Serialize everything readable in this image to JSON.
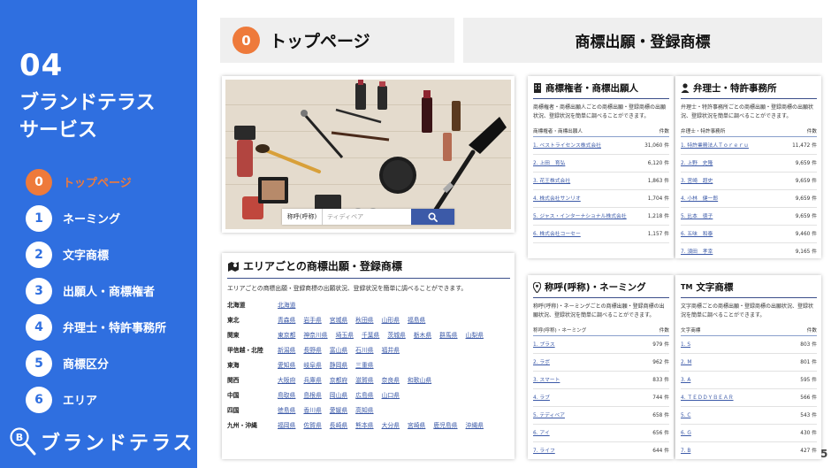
{
  "sidebar": {
    "number": "04",
    "title_line1": "ブランドテラス",
    "title_line2": "サービス",
    "menu": [
      {
        "num": "0",
        "label": "トップページ",
        "active": true
      },
      {
        "num": "1",
        "label": "ネーミング",
        "active": false
      },
      {
        "num": "2",
        "label": "文字商標",
        "active": false
      },
      {
        "num": "3",
        "label": "出願人・商標権者",
        "active": false
      },
      {
        "num": "4",
        "label": "弁理士・特許事務所",
        "active": false
      },
      {
        "num": "5",
        "label": "商標区分",
        "active": false
      },
      {
        "num": "6",
        "label": "エリア",
        "active": false
      }
    ],
    "brand": "ブランドテラス",
    "brand_icon_letter": "B"
  },
  "header": {
    "left_num": "0",
    "left_title": "トップページ",
    "right_title": "商標出願・登録商標"
  },
  "hero": {
    "search_select": "称呼(呼称)",
    "search_placeholder": "ティディベア"
  },
  "area_card": {
    "title": "エリアごとの商標出願・登録商標",
    "desc": "エリアごとの商標出願・登録商標の出願状況、登録状況を簡単に調べることができます。",
    "rows": [
      {
        "region": "北海道",
        "prefs": [
          "北海道"
        ]
      },
      {
        "region": "東北",
        "prefs": [
          "青森県",
          "岩手県",
          "宮城県",
          "秋田県",
          "山形県",
          "福島県"
        ]
      },
      {
        "region": "関東",
        "prefs": [
          "東京都",
          "神奈川県",
          "埼玉県",
          "千葉県",
          "茨城県",
          "栃木県",
          "群馬県",
          "山梨県"
        ]
      },
      {
        "region": "甲信越・北陸",
        "prefs": [
          "新潟県",
          "長野県",
          "富山県",
          "石川県",
          "福井県"
        ]
      },
      {
        "region": "東海",
        "prefs": [
          "愛知県",
          "岐阜県",
          "静岡県",
          "三重県"
        ]
      },
      {
        "region": "関西",
        "prefs": [
          "大阪府",
          "兵庫県",
          "京都府",
          "滋賀県",
          "奈良県",
          "和歌山県"
        ]
      },
      {
        "region": "中国",
        "prefs": [
          "鳥取県",
          "島根県",
          "岡山県",
          "広島県",
          "山口県"
        ]
      },
      {
        "region": "四国",
        "prefs": [
          "徳島県",
          "香川県",
          "愛媛県",
          "高知県"
        ]
      },
      {
        "region": "九州・沖縄",
        "prefs": [
          "福岡県",
          "佐賀県",
          "長崎県",
          "熊本県",
          "大分県",
          "宮崎県",
          "鹿児島県",
          "沖縄県"
        ]
      }
    ]
  },
  "owner_card": {
    "title": "商標権者・商標出願人",
    "desc": "商標権者・商標出願人ごとの商標出願・登録商標の出願状況、登録状況を簡単に調べることができます。",
    "col_name": "商標権者・商標出願人",
    "col_count": "件数",
    "rows": [
      {
        "name": "1. ベストライセンス株式会社",
        "count": "31,060 件"
      },
      {
        "name": "2. 上田　育弘",
        "count": "6,120 件"
      },
      {
        "name": "3. 花王株式会社",
        "count": "1,863 件"
      },
      {
        "name": "4. 株式会社サンリオ",
        "count": "1,704 件"
      },
      {
        "name": "5. ジャス・インターナショナル株式会社",
        "count": "1,218 件"
      },
      {
        "name": "6. 株式会社コーセー",
        "count": "1,157 件"
      }
    ]
  },
  "attorney_card": {
    "title": "弁理士・特許事務所",
    "desc": "弁理士・特許事務所ごとの商標出願・登録商標の出願状況、登録状況を簡単に調べることができます。",
    "col_name": "弁理士・特許事務所",
    "col_count": "件数",
    "rows": [
      {
        "name": "1. 特許業務法人Ｔｏｒｅｒｕ",
        "count": "11,472 件"
      },
      {
        "name": "2. 上野　史隆",
        "count": "9,659 件"
      },
      {
        "name": "3. 宮崎　超史",
        "count": "9,659 件"
      },
      {
        "name": "4. 小林　健一郎",
        "count": "9,659 件"
      },
      {
        "name": "5. 比本　徳子",
        "count": "9,659 件"
      },
      {
        "name": "6. 五味　和泰",
        "count": "9,460 件"
      },
      {
        "name": "7. 須田　孝幸",
        "count": "9,165 件"
      }
    ]
  },
  "naming_card": {
    "title": "称呼(呼称)・ネーミング",
    "desc": "称呼(呼称)・ネーミングごとの商標出願・登録商標の出願状況、登録状況を簡単に調べることができます。",
    "col_name": "称呼(呼称)・ネーミング",
    "col_count": "件数",
    "rows": [
      {
        "name": "1. プラス",
        "count": "979 件"
      },
      {
        "name": "2. ラボ",
        "count": "962 件"
      },
      {
        "name": "3. スマート",
        "count": "833 件"
      },
      {
        "name": "4. ラブ",
        "count": "744 件"
      },
      {
        "name": "5. テディベア",
        "count": "658 件"
      },
      {
        "name": "6. アイ",
        "count": "656 件"
      },
      {
        "name": "7. ライフ",
        "count": "644 件"
      }
    ]
  },
  "tm_card": {
    "title": "文字商標",
    "title_prefix": "TM",
    "desc": "文字商標ごとの商標出願・登録商標の出願状況、登録状況を簡単に調べることができます。",
    "col_name": "文字商標",
    "col_count": "件数",
    "rows": [
      {
        "name": "1. S",
        "count": "803 件"
      },
      {
        "name": "2. M",
        "count": "801 件"
      },
      {
        "name": "3. A",
        "count": "595 件"
      },
      {
        "name": "4. ＴＥＤＤＹＢＥＡＲ",
        "count": "566 件"
      },
      {
        "name": "5. C",
        "count": "543 件"
      },
      {
        "name": "6. G",
        "count": "430 件"
      },
      {
        "name": "7. B",
        "count": "427 件"
      }
    ]
  },
  "page_number": "5",
  "colors": {
    "sidebar": "#2f6fe0",
    "accent": "#ee7a3b",
    "link": "#3c5aa8",
    "header_bg": "#efefef"
  }
}
